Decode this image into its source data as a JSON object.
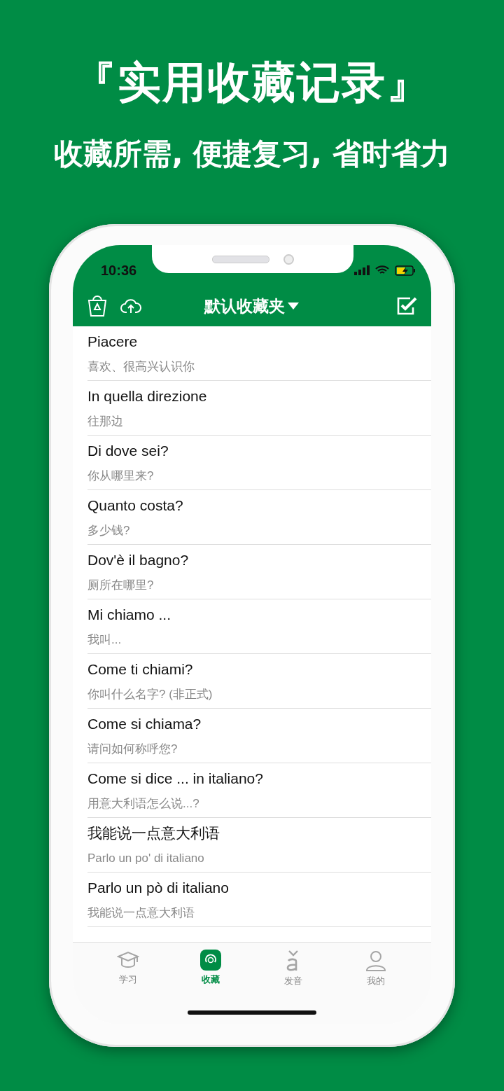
{
  "headline": "『实用收藏记录』",
  "tagline": "收藏所需, 便捷复习, 省时省力",
  "status_bar": {
    "time": "10:36"
  },
  "nav_bar": {
    "title": "默认收藏夹"
  },
  "phrases": [
    {
      "text": "Piacere",
      "translation": "喜欢、很高兴认识你"
    },
    {
      "text": "In quella direzione",
      "translation": "往那边"
    },
    {
      "text": "Di dove sei?",
      "translation": "你从哪里来?"
    },
    {
      "text": "Quanto costa?",
      "translation": "多少钱?"
    },
    {
      "text": "Dov'è il bagno?",
      "translation": "厕所在哪里?"
    },
    {
      "text": "Mi chiamo ...",
      "translation": "我叫..."
    },
    {
      "text": "Come ti chiami?",
      "translation": "你叫什么名字? (非正式)"
    },
    {
      "text": "Come si chiama?",
      "translation": "请问如何称呼您?"
    },
    {
      "text": "Come si dice ... in italiano?",
      "translation": "用意大利语怎么说...?"
    },
    {
      "text": "我能说一点意大利语",
      "translation": "Parlo un po' di italiano"
    },
    {
      "text": "Parlo un pò di italiano",
      "translation": "我能说一点意大利语"
    }
  ],
  "tabs": [
    {
      "kind": "study",
      "label": "学习",
      "selected": false
    },
    {
      "kind": "favorites",
      "label": "收藏",
      "selected": true
    },
    {
      "kind": "pronunciation",
      "label": "发音",
      "selected": false
    },
    {
      "kind": "profile",
      "label": "我的",
      "selected": false
    }
  ]
}
